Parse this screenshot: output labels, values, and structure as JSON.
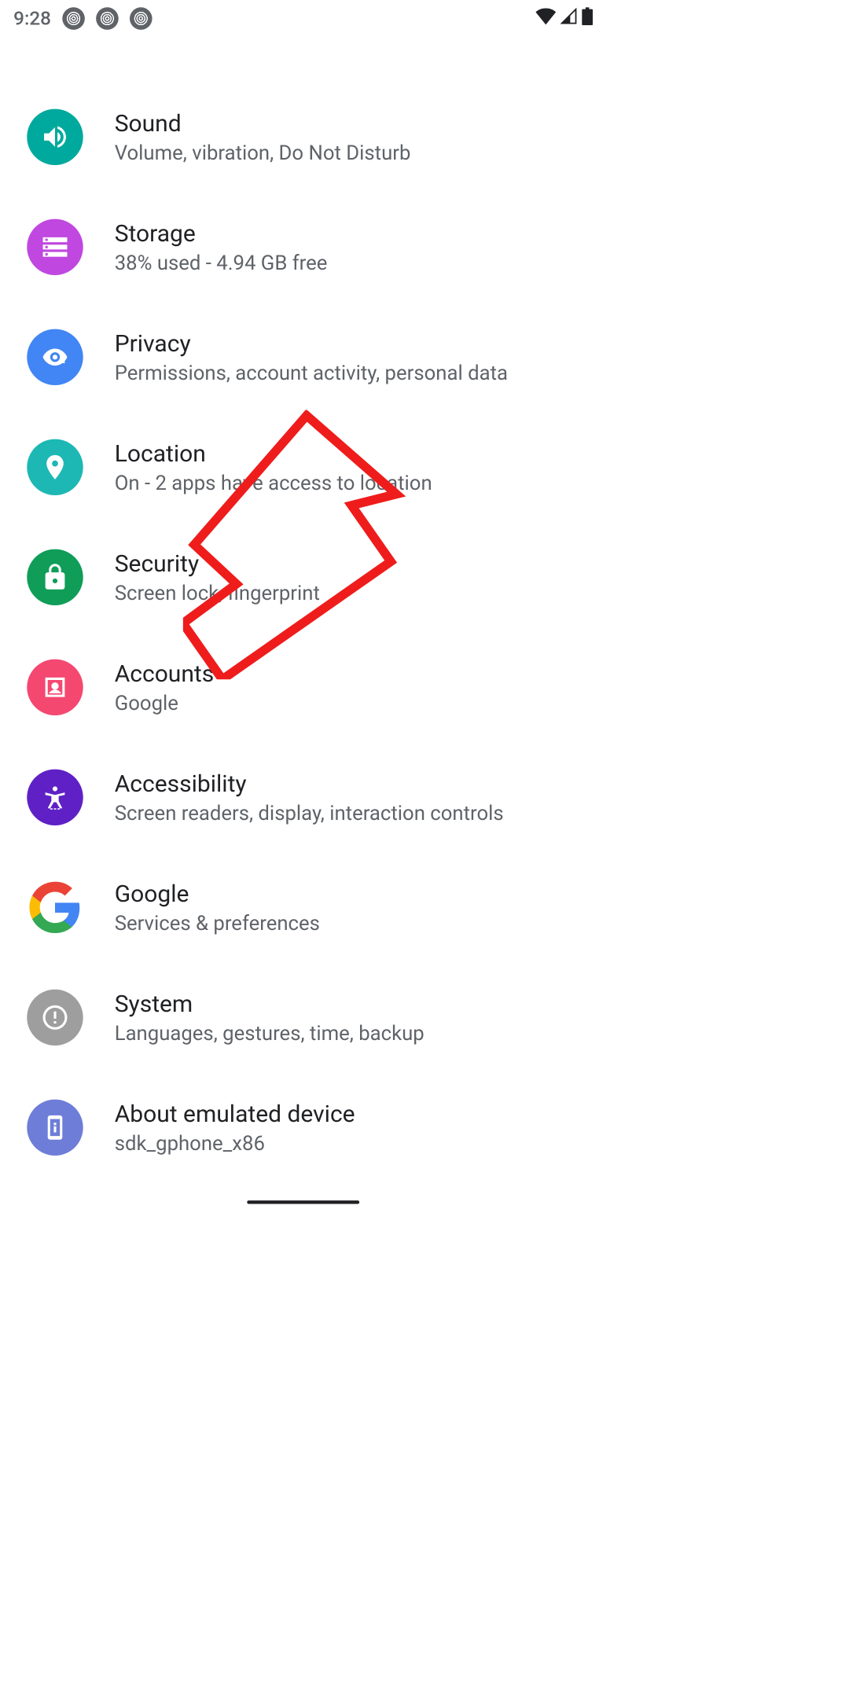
{
  "status": {
    "time": "9:28"
  },
  "items": [
    {
      "title": "Sound",
      "subtitle": "Volume, vibration, Do Not Disturb"
    },
    {
      "title": "Storage",
      "subtitle": "38% used - 4.94 GB free"
    },
    {
      "title": "Privacy",
      "subtitle": "Permissions, account activity, personal data"
    },
    {
      "title": "Location",
      "subtitle": "On - 2 apps have access to location"
    },
    {
      "title": "Security",
      "subtitle": "Screen lock, fingerprint"
    },
    {
      "title": "Accounts",
      "subtitle": "Google"
    },
    {
      "title": "Accessibility",
      "subtitle": "Screen readers, display, interaction controls"
    },
    {
      "title": "Google",
      "subtitle": "Services & preferences"
    },
    {
      "title": "System",
      "subtitle": "Languages, gestures, time, backup"
    },
    {
      "title": "About emulated device",
      "subtitle": "sdk_gphone_x86"
    }
  ]
}
